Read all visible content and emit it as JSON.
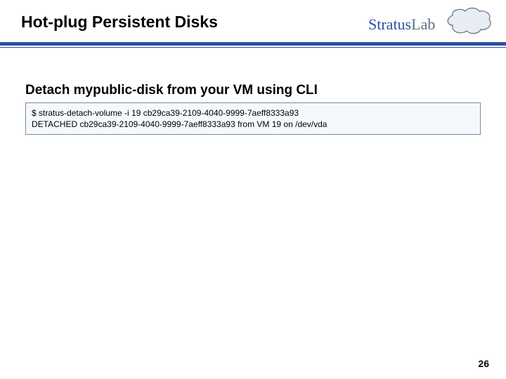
{
  "header": {
    "title": "Hot-plug Persistent Disks",
    "logo": {
      "brand_main": "Stratus",
      "brand_sub": "Lab"
    }
  },
  "content": {
    "subtitle": "Detach  mypublic-disk from your VM using CLI",
    "code_line1": "$ stratus-detach-volume -i 19 cb29ca39-2109-4040-9999-7aeff8333a93",
    "code_line2": "DETACHED cb29ca39-2109-4040-9999-7aeff8333a93 from VM 19 on /dev/vda"
  },
  "page_number": "26"
}
